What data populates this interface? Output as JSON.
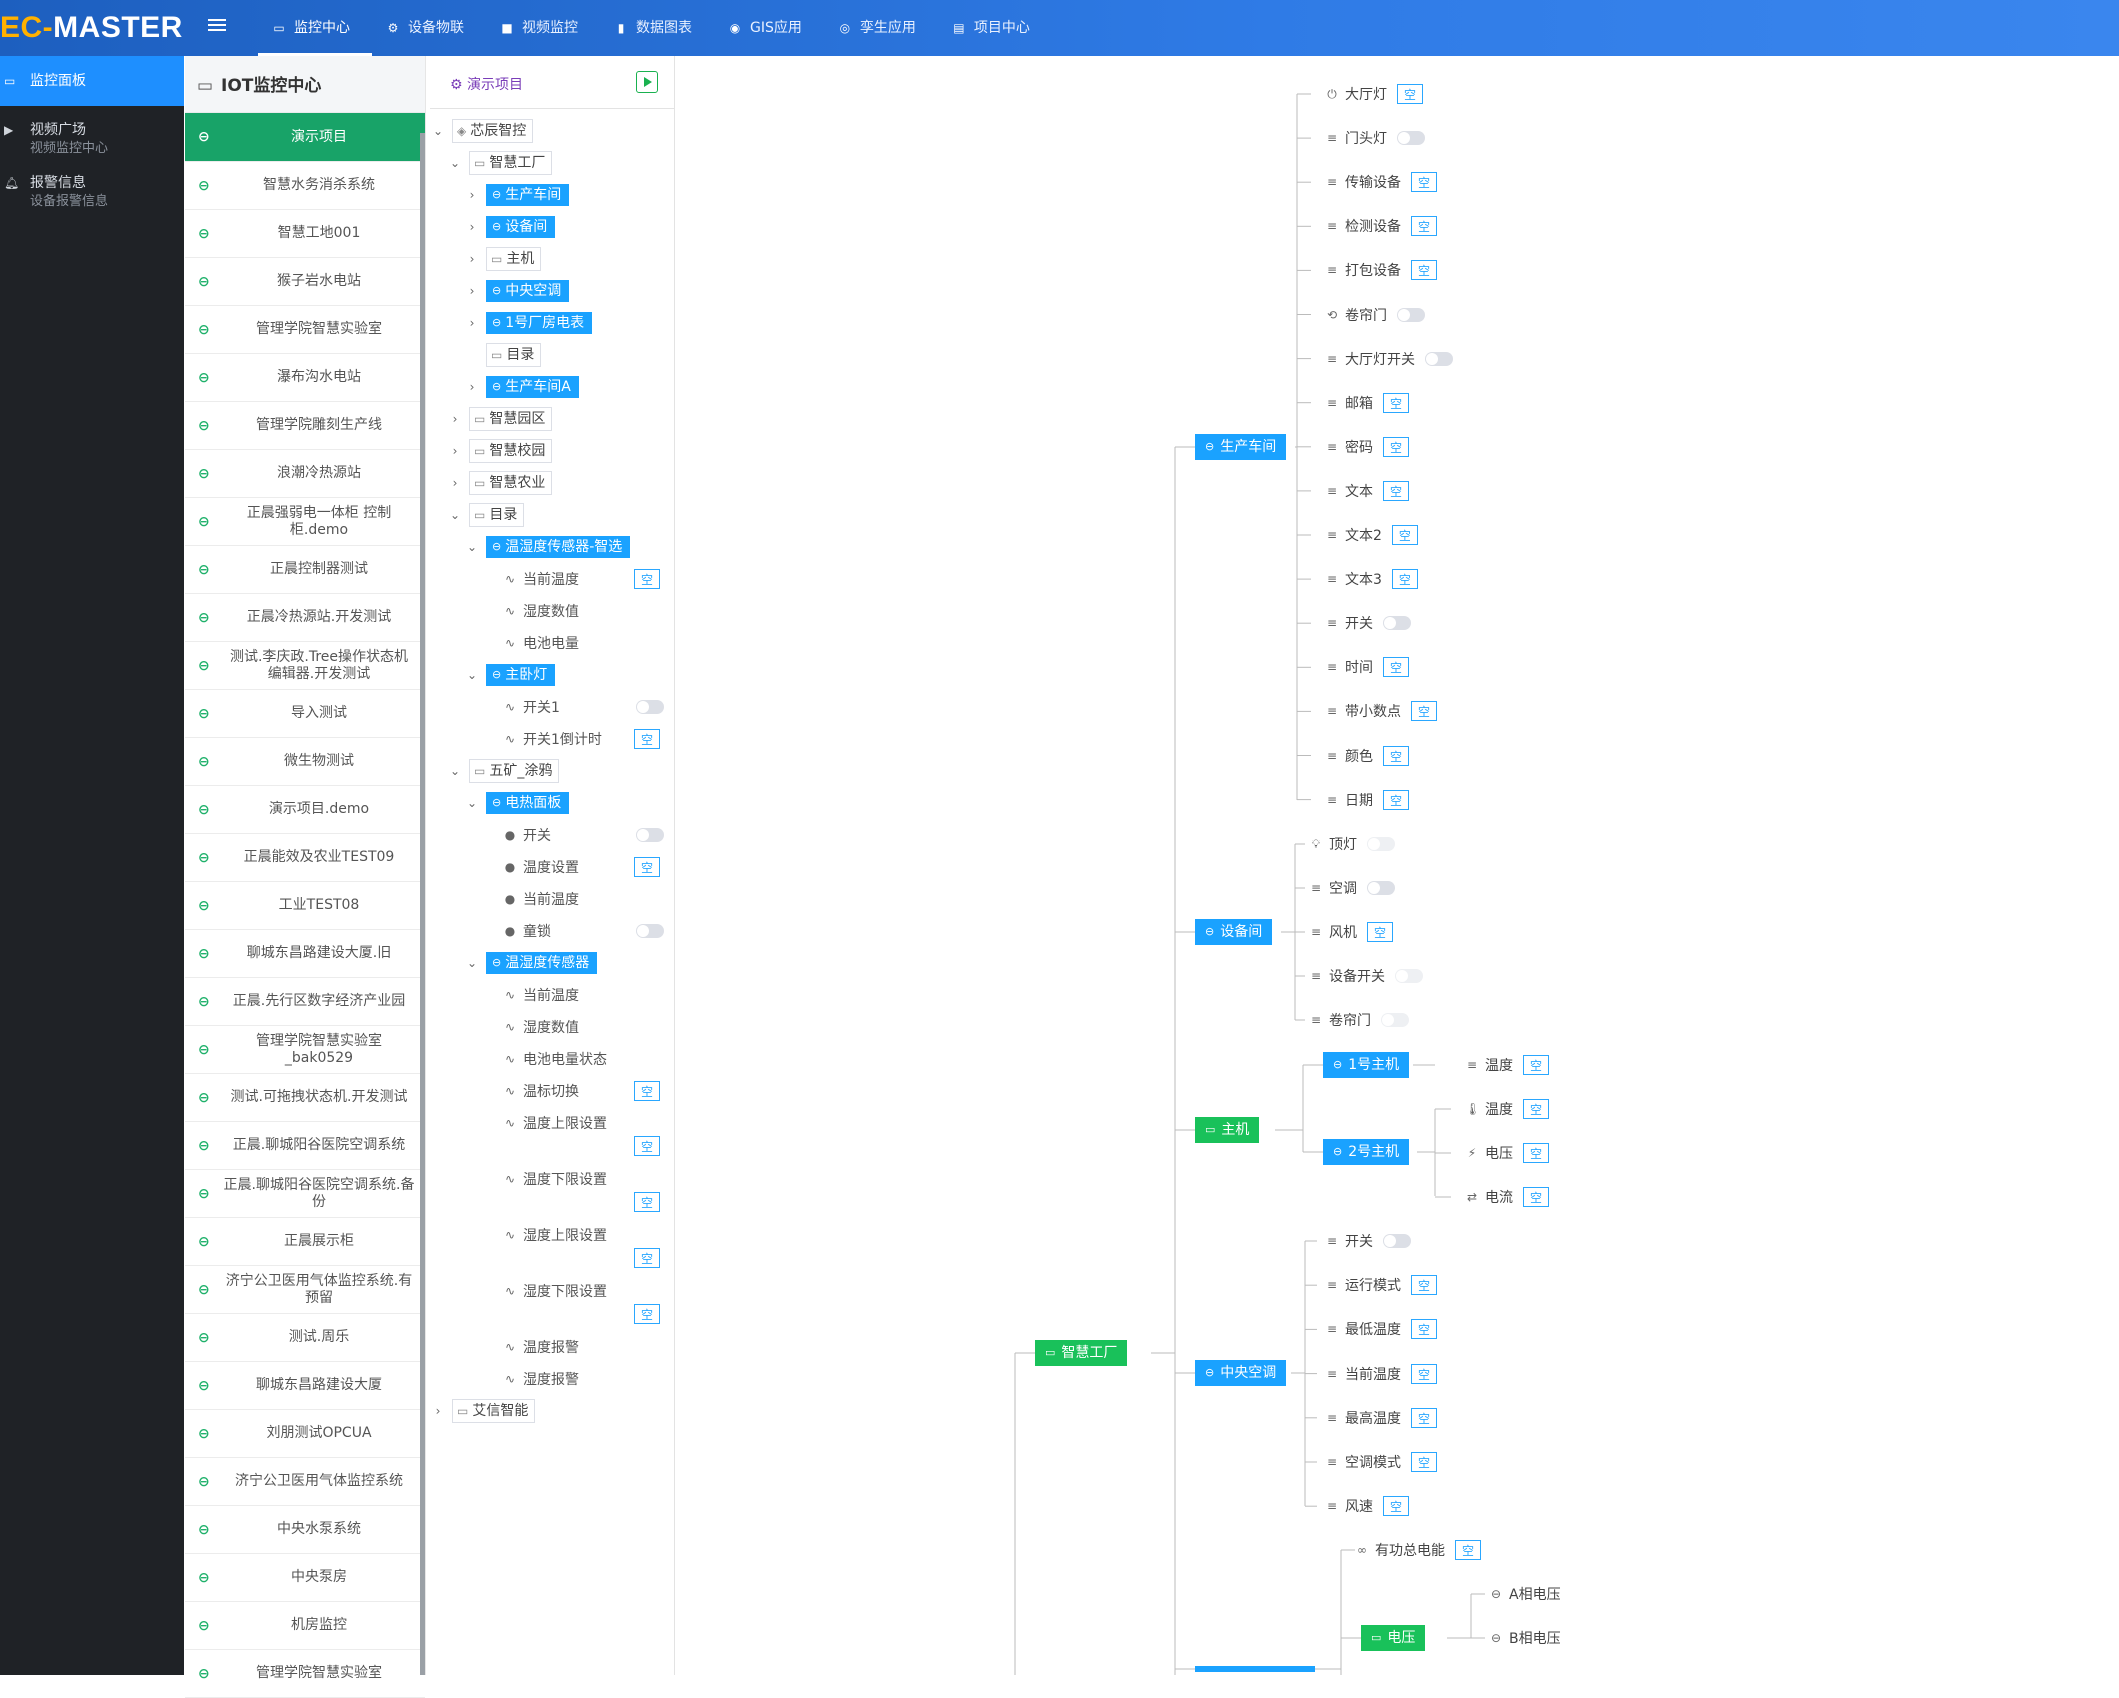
{
  "app": {
    "logo_prefix": "EC-",
    "logo_rest": "MASTER"
  },
  "topnav": [
    {
      "label": "监控中心",
      "icon": "monitor-icon",
      "active": true
    },
    {
      "label": "设备物联",
      "icon": "iot-icon"
    },
    {
      "label": "视频监控",
      "icon": "video-icon"
    },
    {
      "label": "数据图表",
      "icon": "chart-icon"
    },
    {
      "label": "GIS应用",
      "icon": "globe-icon"
    },
    {
      "label": "孪生应用",
      "icon": "twin-icon"
    },
    {
      "label": "项目中心",
      "icon": "project-icon"
    }
  ],
  "sidebar": {
    "active": "监控面板",
    "items": [
      {
        "label": "视频广场",
        "sub": "视频监控中心"
      },
      {
        "label": "报警信息",
        "sub": "设备报警信息"
      }
    ]
  },
  "projects": {
    "title": "IOT监控中心",
    "items": [
      "演示项目",
      "智慧水务消杀系统",
      "智慧工地001",
      "猴子岩水电站",
      "管理学院智慧实验室",
      "瀑布沟水电站",
      "管理学院雕刻生产线",
      "浪潮冷热源站",
      "正晨强弱电一体柜 控制柜.demo",
      "正晨控制器测试",
      "正晨冷热源站.开发测试",
      "测试.李庆政.Tree操作状态机编辑器.开发测试",
      "导入测试",
      "微生物测试",
      "演示项目.demo",
      "正晨能效及农业TEST09",
      "工业TEST08",
      "聊城东昌路建设大厦.旧",
      "正晨.先行区数字经济产业园",
      "管理学院智慧实验室_bak0529",
      "测试.可拖拽状态机.开发测试",
      "正晨.聊城阳谷医院空调系统",
      "正晨.聊城阳谷医院空调系统.备份",
      "正晨展示柜",
      "济宁公卫医用气体监控系统.有预留",
      "测试.周乐",
      "聊城东昌路建设大厦",
      "刘朋测试OPCUA",
      "济宁公卫医用气体监控系统",
      "中央水泵系统",
      "中央泵房",
      "机房监控",
      "管理学院智慧实验室"
    ]
  },
  "tree": {
    "title": "演示项目",
    "empty": "空",
    "nodes": [
      {
        "label": "芯辰智控"
      },
      {
        "label": "智慧工厂"
      },
      {
        "label": "生产车间"
      },
      {
        "label": "设备间"
      },
      {
        "label": "主机"
      },
      {
        "label": "中央空调"
      },
      {
        "label": "1号厂房电表"
      },
      {
        "label": "目录"
      },
      {
        "label": "生产车间A"
      },
      {
        "label": "智慧园区"
      },
      {
        "label": "智慧校园"
      },
      {
        "label": "智慧农业"
      },
      {
        "label": "目录"
      },
      {
        "label": "温湿度传感器-智选"
      },
      {
        "label": "当前温度"
      },
      {
        "label": "湿度数值"
      },
      {
        "label": "电池电量"
      },
      {
        "label": "主卧灯"
      },
      {
        "label": "开关1"
      },
      {
        "label": "开关1倒计时"
      },
      {
        "label": "五矿_涂鸦"
      },
      {
        "label": "电热面板"
      },
      {
        "label": "开关"
      },
      {
        "label": "温度设置"
      },
      {
        "label": "当前温度"
      },
      {
        "label": "童锁"
      },
      {
        "label": "温湿度传感器"
      },
      {
        "label": "当前温度"
      },
      {
        "label": "湿度数值"
      },
      {
        "label": "电池电量状态"
      },
      {
        "label": "温标切换"
      },
      {
        "label": "温度上限设置"
      },
      {
        "label": "温度下限设置"
      },
      {
        "label": "湿度上限设置"
      },
      {
        "label": "湿度下限设置"
      },
      {
        "label": "温度报警"
      },
      {
        "label": "湿度报警"
      },
      {
        "label": "艾信智能"
      }
    ]
  },
  "mindmap": {
    "empty": "空",
    "root": "智慧工厂",
    "branches": [
      "生产车间",
      "设备间",
      "主机",
      "中央空调"
    ],
    "workshop_leaves": [
      "大厅灯",
      "门头灯",
      "传输设备",
      "检测设备",
      "打包设备",
      "卷帘门",
      "大厅灯开关",
      "邮箱",
      "密码",
      "文本",
      "文本2",
      "文本3",
      "开关",
      "时间",
      "带小数点",
      "颜色",
      "日期"
    ],
    "room_leaves": [
      "顶灯",
      "空调",
      "风机",
      "设备开关",
      "卷帘门"
    ],
    "hosts": [
      "1号主机",
      "2号主机"
    ],
    "host1_leaves": [
      "温度"
    ],
    "host2_leaves": [
      "温度",
      "电压",
      "电流"
    ],
    "ac_leaves": [
      "开关",
      "运行模式",
      "最低温度",
      "当前温度",
      "最高温度",
      "空调模式",
      "风速"
    ],
    "meter": {
      "leaf": "有功总电能",
      "group": "电压",
      "group_leaves": [
        "A相电压",
        "B相电压"
      ]
    }
  }
}
